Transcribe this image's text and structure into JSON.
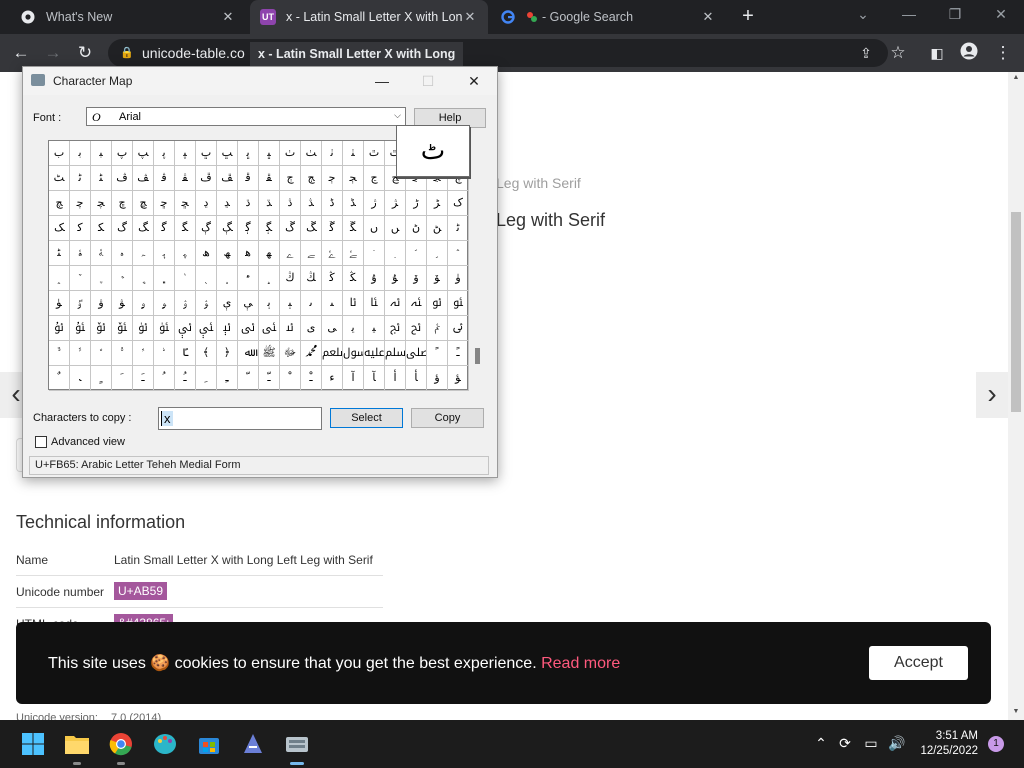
{
  "browser": {
    "tabs": [
      {
        "title": "What's New",
        "favicon": "chrome-icon"
      },
      {
        "title": "x - Latin Small Letter X with Long",
        "favicon": "UT"
      },
      {
        "title": "- Google Search",
        "favicon": "google-icon"
      }
    ],
    "new_tab_symbol": "+",
    "url": "unicode-table.co",
    "tooltip": "x - Latin Small Letter X with Long"
  },
  "page": {
    "breadcrumb_fragment": "Leg with Serif",
    "title_fragment": "Leg with Serif",
    "technical_heading": "Technical information",
    "rows": [
      {
        "key": "Name",
        "value": "Latin Small Letter X with Long Left Leg with Serif",
        "badge": false
      },
      {
        "key": "Unicode number",
        "value": "U+AB59",
        "badge": true
      },
      {
        "key": "HTML-code",
        "value": "&#43865;",
        "badge": true
      }
    ],
    "unicode_version_label": "Unicode version:",
    "unicode_version_value": "7.0 (2014)"
  },
  "cookie": {
    "message": "This site uses 🍪 cookies to ensure that you get the best experience.",
    "read_more": "Read more",
    "accept": "Accept"
  },
  "charmap": {
    "title": "Character Map",
    "font_label": "Font :",
    "font_value": "Arial",
    "font_icon": "O",
    "help": "Help",
    "zoom_char": "ٹ",
    "rows": [
      [
        "ب",
        "ﺑ",
        "ﺒ",
        "ﭖ",
        "ﭗ",
        "ﭘ",
        "ﭙ",
        "ﭚ",
        "ﭛ",
        "ﭜ",
        "ﭝ",
        "ﭞ",
        "ﭟ",
        "ﭠ",
        "ﭡ",
        "ﭢ",
        "ﭣ",
        "ﭤ",
        "ﭥ",
        "ﭦ"
      ],
      [
        "ﭧ",
        "ﭨ",
        "ﭩ",
        "ﭪ",
        "ﭫ",
        "ﭬ",
        "ﭭ",
        "ﭮ",
        "ﭯ",
        "ﭰ",
        "ﭱ",
        "ﭲ",
        "ﭳ",
        "ﭴ",
        "ﭵ",
        "ﭶ",
        "ﭷ",
        "ﭸ",
        "ﭹ",
        "ﭺ"
      ],
      [
        "ﭻ",
        "ﭼ",
        "ﭽ",
        "ﭾ",
        "ﭿ",
        "ﮀ",
        "ﮁ",
        "ﮂ",
        "ﮃ",
        "ﮄ",
        "ﮅ",
        "ﮆ",
        "ﮇ",
        "ﮈ",
        "ﮉ",
        "ﮊ",
        "ﮋ",
        "ﮌ",
        "ﮍ",
        "ﮎ"
      ],
      [
        "ﮏ",
        "ﮐ",
        "ﮑ",
        "ﮒ",
        "ﮓ",
        "ﮔ",
        "ﮕ",
        "ﮖ",
        "ﮗ",
        "ﮘ",
        "ﮙ",
        "ﮚ",
        "ﮛ",
        "ﮜ",
        "ﮝ",
        "ﮞ",
        "ﮟ",
        "ﮠ",
        "ﮡ",
        "ﮢ"
      ],
      [
        "ﮣ",
        "ﮤ",
        "ﮥ",
        "ﮦ",
        "ﮧ",
        "ﮨ",
        "ﮩ",
        "ﮪ",
        "ﮫ",
        "ﮬ",
        "ﮭ",
        "ﮮ",
        "ﮯ",
        "ﮰ",
        "ﮱ",
        "﮲",
        "﮳",
        "﮴",
        "﮵",
        "﮶"
      ],
      [
        "﮷",
        "﮸",
        "﮹",
        "﮺",
        "﮻",
        "﮼",
        "﮽",
        "﮾",
        "﮿",
        "﯀",
        "﯁",
        "ﯓ",
        "ﯔ",
        "ﯕ",
        "ﯖ",
        "ﯗ",
        "ﯘ",
        "ﯙ",
        "ﯚ",
        "ﯛ"
      ],
      [
        "ﯜ",
        "ﯝ",
        "ﯞ",
        "ﯟ",
        "ﯠ",
        "ﯡ",
        "ﯢ",
        "ﯣ",
        "ﯤ",
        "ﯥ",
        "ﯦ",
        "ﯧ",
        "ﯨ",
        "ﯩ",
        "ﯪ",
        "ﯫ",
        "ﯬ",
        "ﯭ",
        "ﯮ",
        "ﯯ"
      ],
      [
        "ﯰ",
        "ﯱ",
        "ﯲ",
        "ﯳ",
        "ﯴ",
        "ﯵ",
        "ﯶ",
        "ﯷ",
        "ﯸ",
        "ﯹ",
        "ﯺ",
        "ﯻ",
        "ﯼ",
        "ﯽ",
        "ﯾ",
        "ﯿ",
        "ﰀ",
        "ﰁ",
        "ﰂ",
        "ﰃ"
      ],
      [
        "ﱞ",
        "ﱟ",
        "ﱠ",
        "ﱡ",
        "ﱢ",
        "ﱣ",
        "ﴼ",
        "﴾",
        "﴿",
        "ﷲ",
        "ﷺ",
        "ﷻ",
        "ﷴ",
        "ﷵ",
        "ﷶ",
        "ﷷ",
        "ﷸ",
        "ﷹ",
        "ﹰ",
        "ﹱ"
      ],
      [
        "ﹲ",
        "ﹳ",
        "ﹴ",
        "ﹶ",
        "ﹷ",
        "ﹸ",
        "ﹹ",
        "ﹺ",
        "ﹻ",
        "ﹼ",
        "ﹽ",
        "ﹾ",
        "ﹿ",
        "ﺀ",
        "ﺁ",
        "ﺂ",
        "ﺃ",
        "ﺄ",
        "ﺅ",
        "ﺆ"
      ]
    ],
    "copy_label": "Characters to copy :",
    "copy_value": "x",
    "select": "Select",
    "copy": "Copy",
    "advanced": "Advanced view",
    "status": "U+FB65: Arabic Letter Teheh Medial Form"
  },
  "taskbar": {
    "time": "3:51 AM",
    "date": "12/25/2022",
    "notifications": "1"
  },
  "colors": {
    "accept_link": "#ff5a7e",
    "badge": "#a4579c",
    "taskbar_active": "#76b9ed"
  }
}
